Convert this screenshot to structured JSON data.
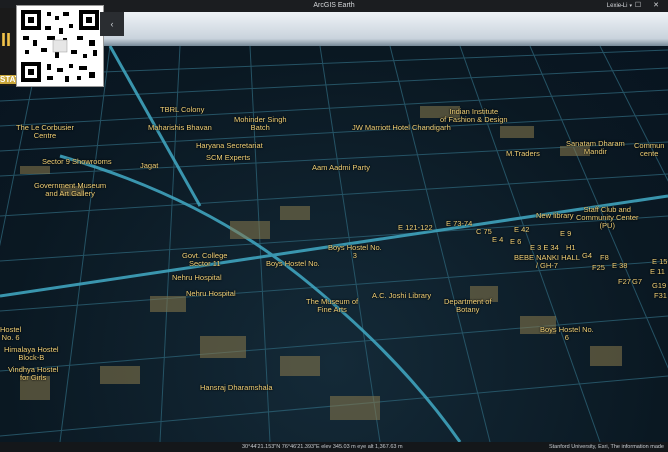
{
  "window": {
    "title": "ArcGIS Earth",
    "user": "Lexie Li",
    "controls": "–  ☐  ✕"
  },
  "toolbar": {
    "collapse_glyph": "‹"
  },
  "logo": {
    "text": "STATE",
    "mark": "II"
  },
  "status": {
    "coordinates": "30°44'21.153\"N 76°46'21.393\"E  elev 345.03 m  eye alt 1,367.63 m",
    "attribution": "Stanford University, Esri, The information made"
  },
  "map_labels": [
    "TBRL Colony",
    "Mohinder Singh\nBatch",
    "Indian Institute\nof Fashion & Design",
    "The Le Corbusier\nCentre",
    "Maharishis Bhavan",
    "JW Marriott Hotel Chandigarh",
    "Haryana Secretariat",
    "SCM Experts",
    "Sanatam Dharam\nMandir",
    "Commun\ncente",
    "M.Traders",
    "Sector 9 Showrooms",
    "Jagat",
    "Aam Aadmi Party",
    "Government Museum\nand Art Gallery",
    "Staff Club and\nCommunity Center\n(PU)",
    "New library",
    "E 121-122",
    "E 73-74",
    "C 75",
    "E 42",
    "E 9",
    "E 4",
    "E 6",
    "E 3 E 34",
    "H1",
    "Govt. College\nSector 11",
    "Boys Hostel No.\n3",
    "BEBE NANKI HALL\n/ GH-7",
    "G4",
    "F8",
    "F25",
    "E 38",
    "E 11",
    "Boys Hostel No.",
    "Nehru Hospital",
    "Nehru Hospital",
    "G7",
    "F27",
    "E 15",
    "G19",
    "F31",
    "The Museum of\nFine Arts",
    "A.C. Joshi Library",
    "Department of\nBotany",
    "Boys Hostel No.\n6",
    "Hostel\nNo. 6",
    "Himalaya Hostel\nBlock-B",
    "Vindhya Hostel\nfor Girls",
    "Hansraj Dharamshala"
  ]
}
